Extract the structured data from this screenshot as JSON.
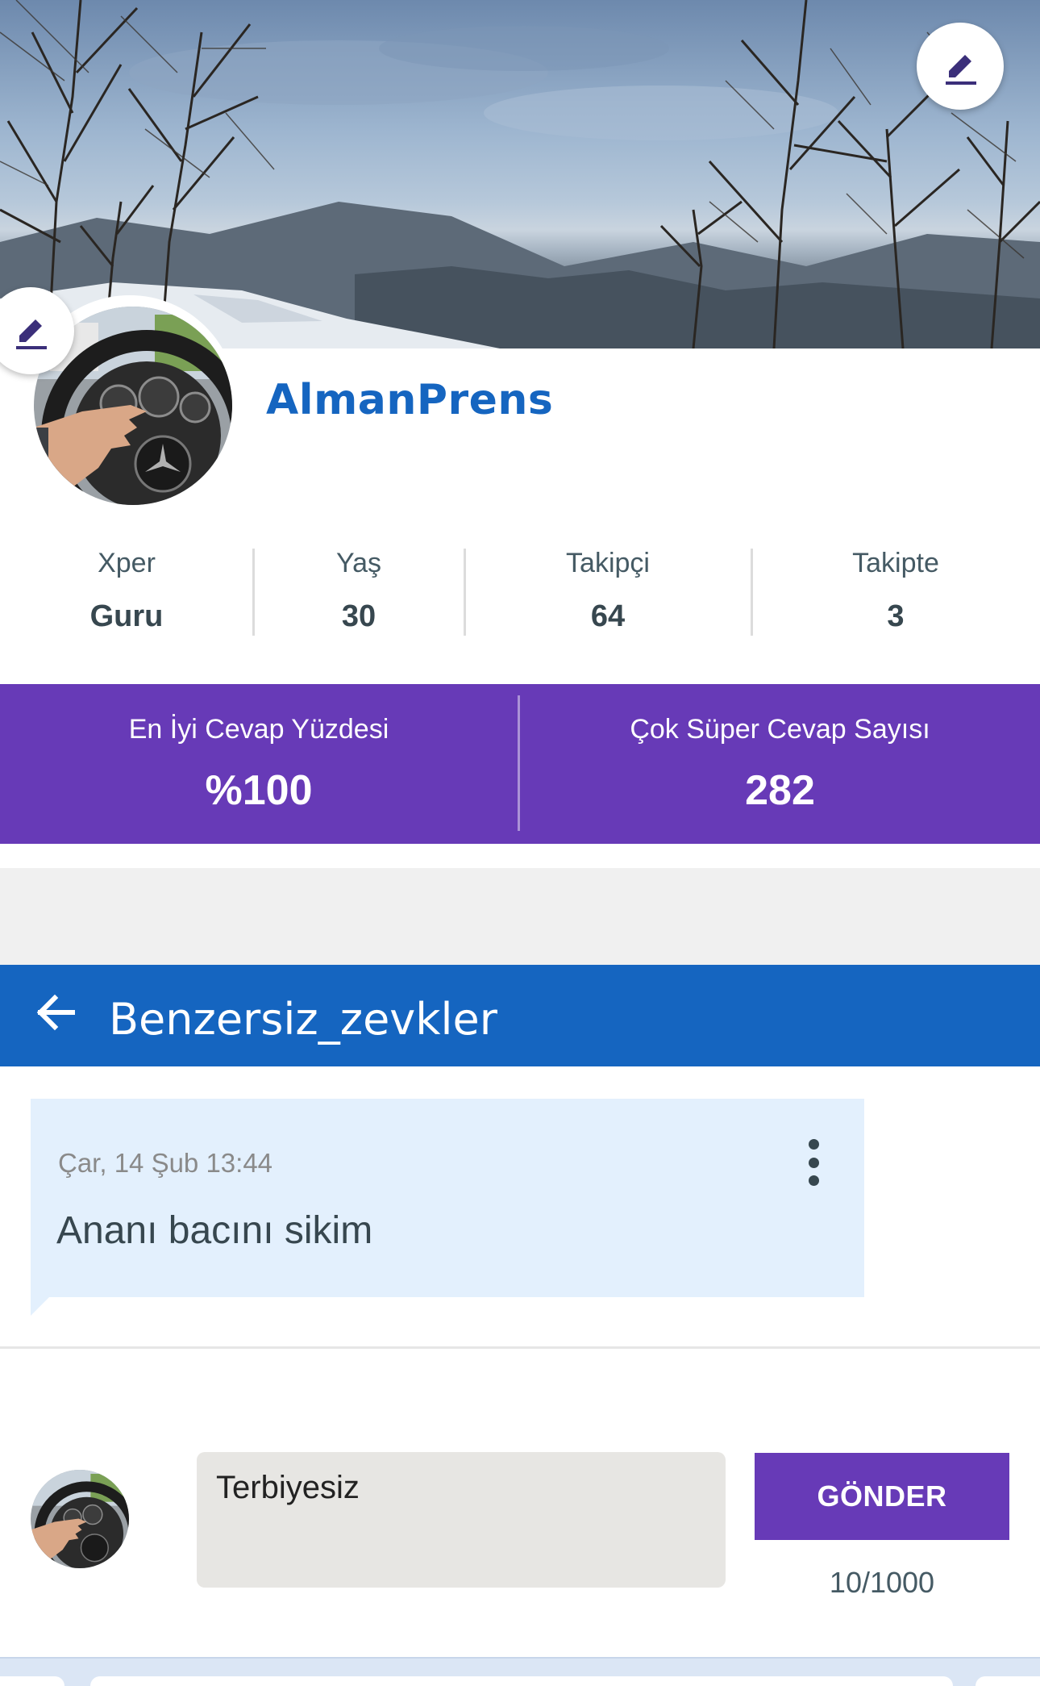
{
  "profile": {
    "username": "AlmanPrens"
  },
  "stats": [
    {
      "label": "Xper",
      "value": "Guru"
    },
    {
      "label": "Yaş",
      "value": "30"
    },
    {
      "label": "Takipçi",
      "value": "64"
    },
    {
      "label": "Takipte",
      "value": "3"
    }
  ],
  "highlights": [
    {
      "label": "En İyi Cevap Yüzdesi",
      "value": "%100"
    },
    {
      "label": "Çok Süper Cevap Sayısı",
      "value": "282"
    }
  ],
  "conversation": {
    "title": "Benzersiz_zevkler",
    "message": {
      "date": "Çar, 14 Şub 13:44",
      "text": "Ananı bacını sikim"
    }
  },
  "reply": {
    "value": "Terbiyesiz",
    "send_label": "GÖNDER",
    "counter": "10/1000"
  },
  "colors": {
    "primary_blue": "#1565c0",
    "accent_purple": "#673ab7",
    "message_bg": "#e3f0fd"
  },
  "icons": {
    "cover_edit": "pencil-icon",
    "avatar_edit": "pencil-icon",
    "back": "arrow-left-icon",
    "message_menu": "more-vertical-icon"
  }
}
